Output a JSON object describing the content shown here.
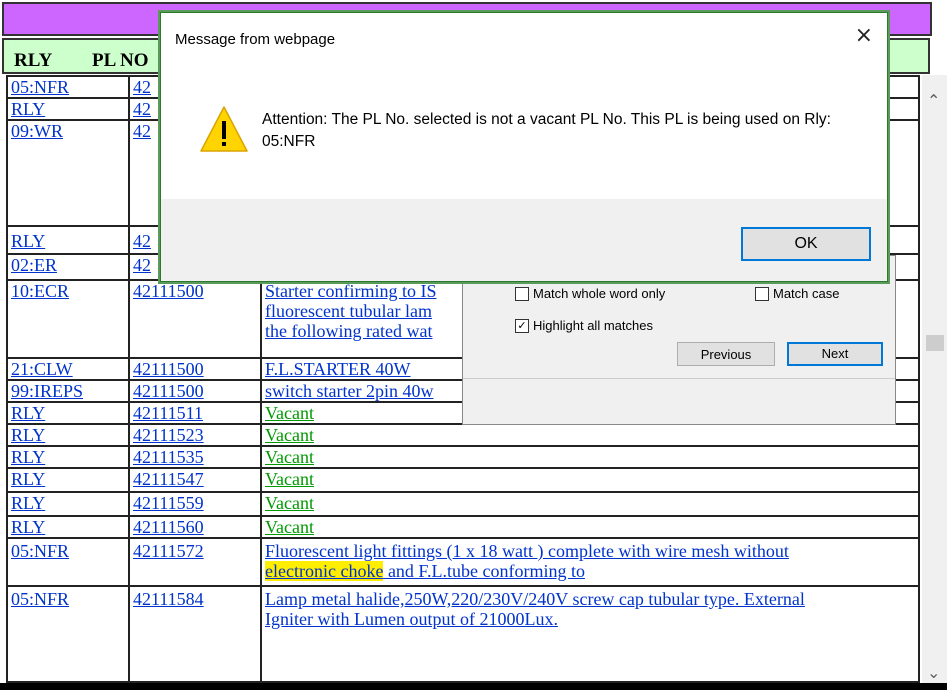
{
  "table": {
    "headers": [
      "RLY",
      "PL NO"
    ],
    "rows": [
      {
        "rly": "05:NFR",
        "pl": "42",
        "desc": ""
      },
      {
        "rly": "RLY",
        "pl": "42",
        "desc": ""
      },
      {
        "rly": "09:WR",
        "pl": "42",
        "desc": ""
      },
      {
        "rly": "RLY",
        "pl": "42",
        "desc": ""
      },
      {
        "rly": "02:ER",
        "pl": "42",
        "desc": ""
      },
      {
        "rly": "10:ECR",
        "pl": "42111500",
        "desc": "Starter confirming to IS",
        "desc2": "fluorescent tubular lam",
        "desc3": "the following rated wat"
      },
      {
        "rly": "21:CLW",
        "pl": "42111500",
        "desc": "F.L.STARTER 40W"
      },
      {
        "rly": "99:IREPS",
        "pl": "42111500",
        "desc": "switch starter 2pin 40w"
      },
      {
        "rly": "RLY",
        "pl": "42111511",
        "desc": "Vacant"
      },
      {
        "rly": "RLY",
        "pl": "42111523",
        "desc": "Vacant"
      },
      {
        "rly": "RLY",
        "pl": "42111535",
        "desc": "Vacant"
      },
      {
        "rly": "RLY",
        "pl": "42111547",
        "desc": "Vacant"
      },
      {
        "rly": "RLY",
        "pl": "42111559",
        "desc": "Vacant"
      },
      {
        "rly": "RLY",
        "pl": "42111560",
        "desc": "Vacant"
      },
      {
        "rly": "05:NFR",
        "pl": "42111572",
        "desc": "Fluorescent light fittings (1 x 18 watt ) complete with wire mesh without",
        "desc_hl": "electronic choke",
        "desc_tail": " and F.L.tube conforming to"
      },
      {
        "rly": "05:NFR",
        "pl": "42111584",
        "desc": "Lamp metal halide,250W,220/230V/240V screw cap tubular type. External",
        "desc2": "Igniter with Lumen output of 21000Lux."
      }
    ]
  },
  "find": {
    "match_whole_word": "Match whole word only",
    "match_case": "Match case",
    "highlight_all": "Highlight all matches",
    "previous": "Previous",
    "next": "Next"
  },
  "dialog": {
    "title": "Message from webpage",
    "close": "×",
    "message": "Attention: The PL No. selected is not a vacant PL No. This PL is being used on Rly: 05:NFR",
    "ok": "OK"
  },
  "colors": {
    "header_purple": "#cc66ff",
    "header_green": "#ccffcc",
    "row_bg": "#ccffee",
    "link": "#0033cc",
    "vacant": "#009900",
    "highlight": "#ffee00"
  }
}
